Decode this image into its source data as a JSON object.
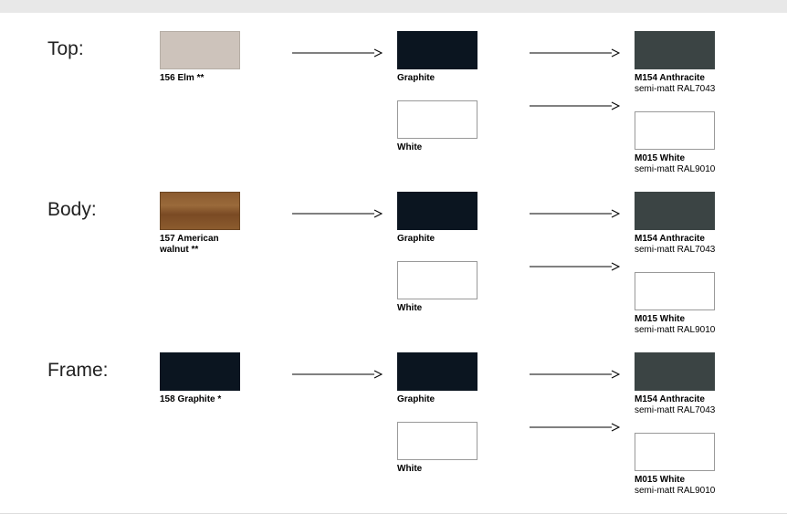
{
  "sections": [
    {
      "label": "Top:",
      "source": {
        "label": "156 Elm **"
      },
      "options": [
        {
          "mid_label": "Graphite",
          "right_label": "M154 Anthracite",
          "right_sub": "semi-matt RAL7043"
        },
        {
          "mid_label": "White",
          "right_label": "M015 White",
          "right_sub": "semi-matt RAL9010"
        }
      ]
    },
    {
      "label": "Body:",
      "source": {
        "label": "157 American walnut **"
      },
      "options": [
        {
          "mid_label": "Graphite",
          "right_label": "M154 Anthracite",
          "right_sub": "semi-matt RAL7043"
        },
        {
          "mid_label": "White",
          "right_label": "M015 White",
          "right_sub": "semi-matt RAL9010"
        }
      ]
    },
    {
      "label": "Frame:",
      "source": {
        "label": "158 Graphite *"
      },
      "options": [
        {
          "mid_label": "Graphite",
          "right_label": "M154 Anthracite",
          "right_sub": "semi-matt RAL7043"
        },
        {
          "mid_label": "White",
          "right_label": "M015 White",
          "right_sub": "semi-matt RAL9010"
        }
      ]
    }
  ]
}
